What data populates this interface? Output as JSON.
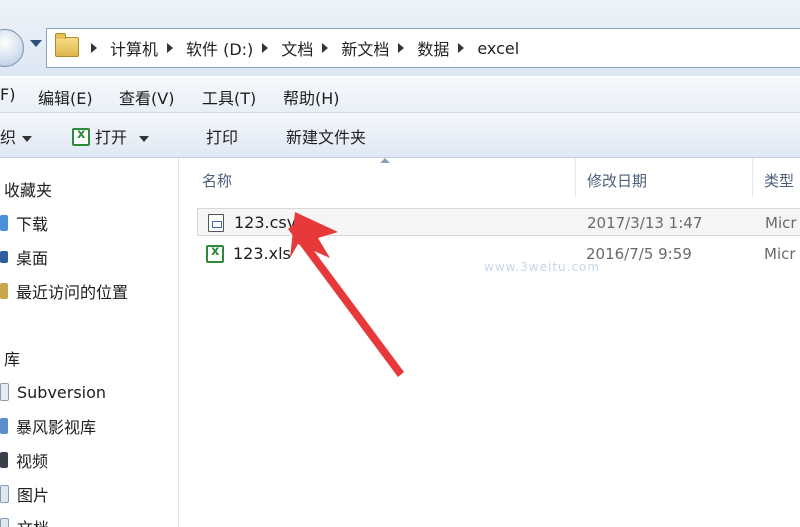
{
  "address_bar": {
    "crumbs": [
      "计算机",
      "软件 (D:)",
      "文档",
      "新文档",
      "数据",
      "excel"
    ]
  },
  "menu": {
    "file_fragment": "F)",
    "edit": "编辑(E)",
    "view": "查看(V)",
    "tools": "工具(T)",
    "help": "帮助(H)"
  },
  "toolbar": {
    "organize_fragment": "织",
    "open": "打开",
    "print": "打印",
    "new_folder": "新建文件夹"
  },
  "nav_pane": {
    "favorites_header": "收藏夹",
    "favorites": [
      "下载",
      "桌面",
      "最近访问的位置"
    ],
    "libraries_header": "库",
    "libraries": [
      "Subversion",
      "暴风影视库",
      "视频",
      "图片",
      "文档"
    ]
  },
  "file_list": {
    "columns": {
      "name": "名称",
      "modified": "修改日期",
      "type": "类型"
    },
    "rows": [
      {
        "name": "123.csv",
        "modified": "2017/3/13 1:47",
        "type": "Micr",
        "icon": "csv-file-icon"
      },
      {
        "name": "123.xls",
        "modified": "2016/7/5 9:59",
        "type": "Micr",
        "icon": "excel-file-icon"
      }
    ]
  },
  "watermark": "www.3weitu.com",
  "colors": {
    "annotation_arrow": "#e8393a",
    "excel_green": "#2f8a3a",
    "selection_bg": "#f5f5f5"
  }
}
